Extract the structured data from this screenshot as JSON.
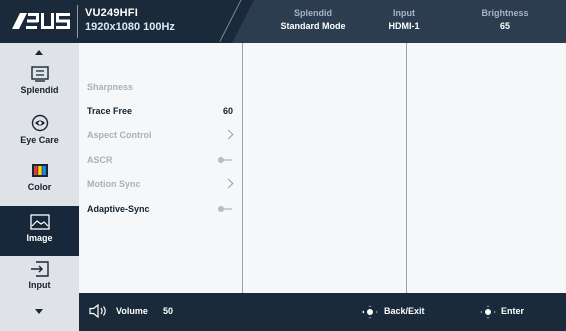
{
  "header": {
    "brand": "ASUS",
    "model": "VU249HFI",
    "resolution": "1920x1080 100Hz",
    "stats": [
      {
        "label": "Splendid",
        "value": "Standard Mode"
      },
      {
        "label": "Input",
        "value": "HDMI-1"
      },
      {
        "label": "Brightness",
        "value": "65"
      }
    ]
  },
  "sidebar": {
    "items": [
      {
        "label": "Splendid",
        "icon": "splendid-icon"
      },
      {
        "label": "Eye Care",
        "icon": "eye-care-icon"
      },
      {
        "label": "Color",
        "icon": "color-icon"
      },
      {
        "label": "Image",
        "icon": "image-icon",
        "active": true
      },
      {
        "label": "Input",
        "icon": "input-icon"
      }
    ]
  },
  "menu": {
    "rows": [
      {
        "label": "Sharpness",
        "state": "disabled"
      },
      {
        "label": "Trace Free",
        "state": "enabled",
        "value": "60"
      },
      {
        "label": "Aspect Control",
        "state": "disabled",
        "control": "chevron"
      },
      {
        "label": "ASCR",
        "state": "disabled",
        "control": "toggle",
        "toggle_on": false
      },
      {
        "label": "Motion Sync",
        "state": "disabled",
        "control": "chevron"
      },
      {
        "label": "Adaptive-Sync",
        "state": "enabled",
        "control": "toggle",
        "toggle_on": false
      }
    ]
  },
  "footer": {
    "volume_label": "Volume",
    "volume_value": "50",
    "back_label": "Back/Exit",
    "enter_label": "Enter"
  },
  "colors": {
    "header_bg": "#1a2a3a",
    "active_bg": "#17283a",
    "sidebar_bg": "#dfe2e6",
    "panel_bg": "#f6f7f8"
  }
}
